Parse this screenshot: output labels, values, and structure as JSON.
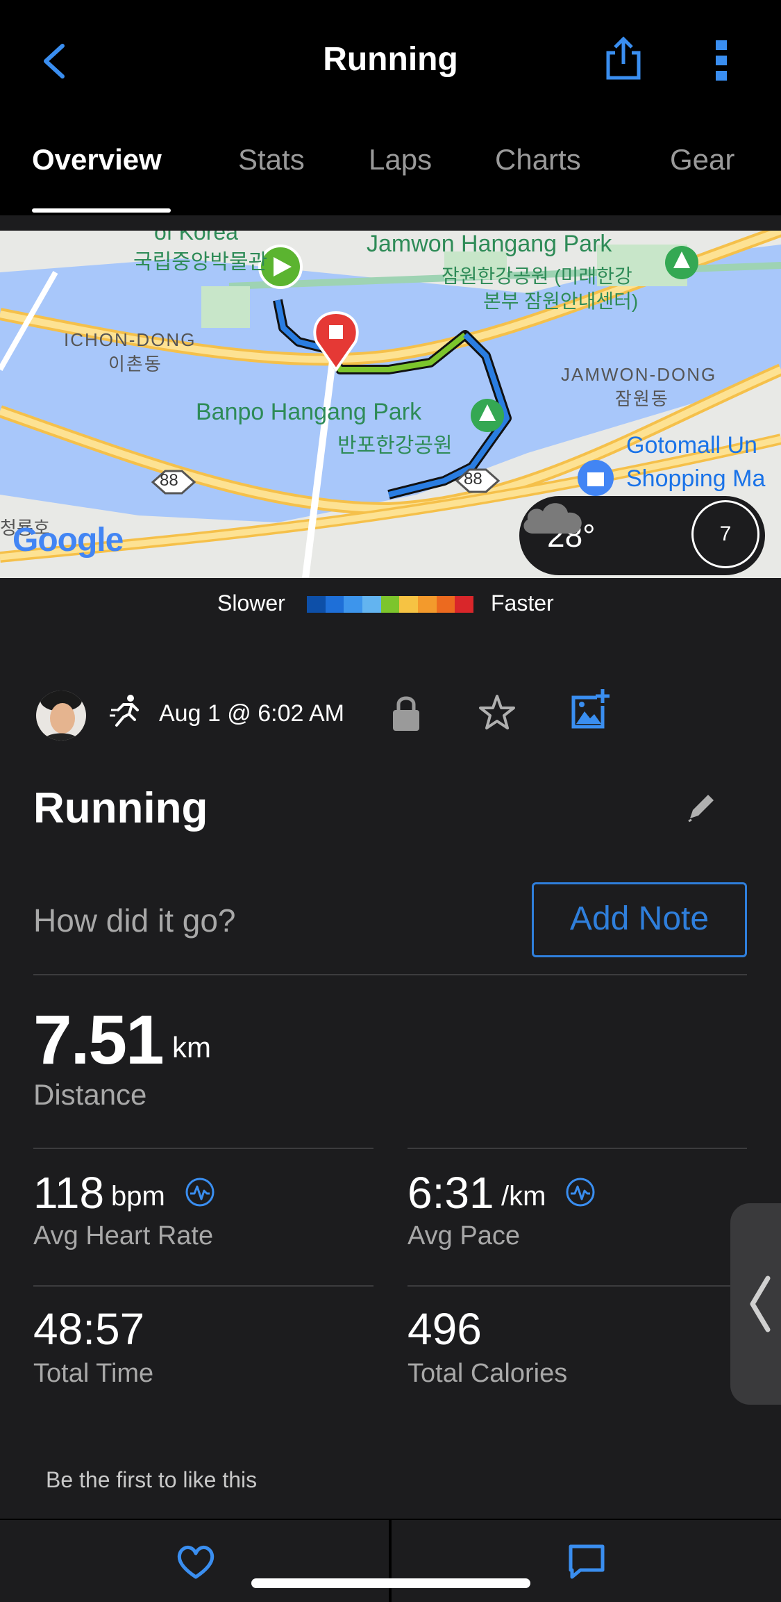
{
  "header": {
    "title": "Running"
  },
  "tabs": [
    {
      "label": "Overview",
      "active": true
    },
    {
      "label": "Stats",
      "active": false
    },
    {
      "label": "Laps",
      "active": false
    },
    {
      "label": "Charts",
      "active": false
    },
    {
      "label": "Gear",
      "active": false
    }
  ],
  "map": {
    "labels": {
      "korea_partial": "of Korea",
      "museum_ko": "국립중앙박물관",
      "jamwon_park": "Jamwon Hangang Park",
      "jamwon_ko_1": "잠원한강공원 (미래한강",
      "jamwon_ko_2": "본부 잠원안내센터)",
      "ichon_dong": "ICHON-DONG",
      "ichon_ko": "이촌동",
      "jamwon_dong": "JAMWON-DONG",
      "jamwon_dong_ko": "잠원동",
      "banpo_park": "Banpo Hangang Park",
      "banpo_ko": "반포한강공원",
      "gotomall_1": "Gotomall Un",
      "gotomall_2": "Shopping Ma",
      "left_edge_ko": "청룡호",
      "route_88_a": "88",
      "route_88_b": "88",
      "google": "Google"
    },
    "weather": {
      "temperature": "28°",
      "condition_icon": "cloud-icon",
      "wind": "7"
    },
    "route_colors": {
      "slow": "#2a7de1",
      "fast": "#7cc52c",
      "start_marker": "#5bb430",
      "end_marker": "#e53935"
    }
  },
  "legend": {
    "slower": "Slower",
    "faster": "Faster",
    "colors": [
      "#0d4fa8",
      "#1e6fd8",
      "#3d95ec",
      "#63b4f0",
      "#7cc52c",
      "#f6c343",
      "#f39a2c",
      "#ec6a1f",
      "#d9262a"
    ]
  },
  "meta": {
    "date": "Aug 1 @ 6:02 AM",
    "activity_icon": "running-icon",
    "privacy_icon": "lock-icon",
    "favorite_icon": "star-icon",
    "add_photo_icon": "add-photo-icon"
  },
  "activity": {
    "name": "Running",
    "note_prompt": "How did it go?",
    "add_note_label": "Add Note"
  },
  "stats": {
    "distance": {
      "value": "7.51",
      "unit": "km",
      "label": "Distance"
    },
    "avg_heart_rate": {
      "value": "118",
      "unit": "bpm",
      "label": "Avg Heart Rate"
    },
    "avg_pace": {
      "value": "6:31",
      "unit": "/km",
      "label": "Avg Pace"
    },
    "total_time": {
      "value": "48:57",
      "label": "Total Time"
    },
    "total_calories": {
      "value": "496",
      "label": "Total Calories"
    }
  },
  "social": {
    "like_prompt": "Be the first to like this"
  },
  "colors": {
    "accent": "#2f7fdc",
    "background": "#1c1c1e",
    "header_bg": "#000000"
  }
}
